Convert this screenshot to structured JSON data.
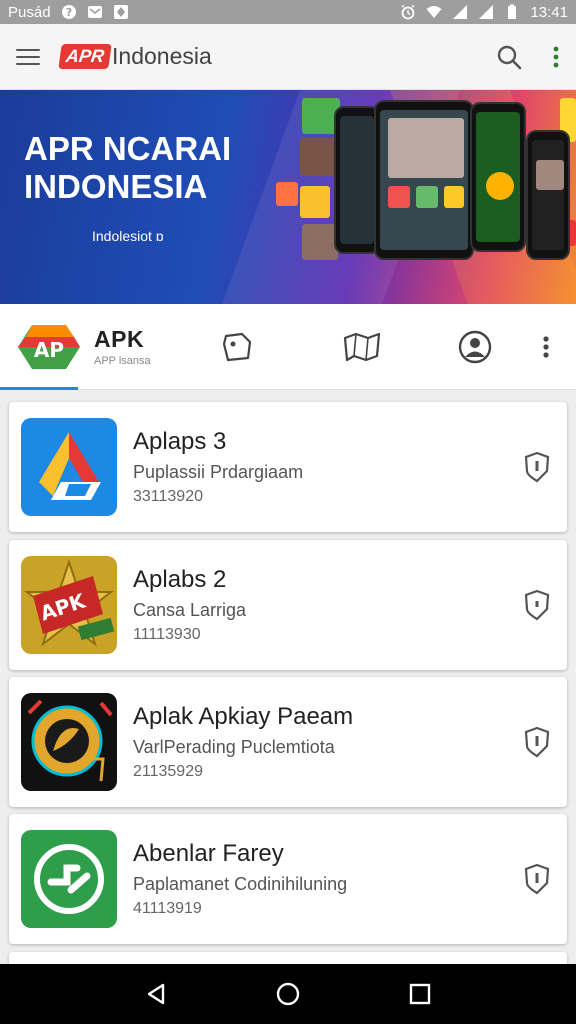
{
  "status_bar": {
    "left_label": "Pusád",
    "time": "13:41",
    "icons": [
      "help-icon",
      "mail-icon",
      "app-icon",
      "alarm-icon",
      "wifi-icon",
      "signal-icon",
      "signal-icon",
      "battery-icon"
    ]
  },
  "app_bar": {
    "brand_badge": "APR",
    "brand_text": "Indonesia",
    "actions": [
      "search-icon",
      "overflow-menu-icon"
    ]
  },
  "banner": {
    "title": "APR NCARAI INDONESIA",
    "subtitle": "Indolesiot ɒ"
  },
  "tabs": {
    "apk_title": "APK",
    "apk_subtitle": "APP lsansa",
    "icons": [
      "tag-icon",
      "map-icon",
      "profile-icon",
      "overflow-menu-icon"
    ]
  },
  "apps": [
    {
      "title": "Aplaps 3",
      "desc": "Puplassii Prdargiaam",
      "num": "33113920",
      "icon": "google-drive-style-icon",
      "action": "shield-icon"
    },
    {
      "title": "Aplabs 2",
      "desc": "Cansa Larriga",
      "num": "11113930",
      "icon": "apk-star-icon",
      "action": "shield-icon"
    },
    {
      "title": "Aplak Apkiay Paeam",
      "desc": "VarlPerading Puclemtiota",
      "num": "21135929",
      "icon": "compass-game-icon",
      "action": "shield-icon"
    },
    {
      "title": "Abenlar Farey",
      "desc": "Paplamanet Codinihiluning",
      "num": "41113919",
      "icon": "green-arrows-icon",
      "action": "shield-icon"
    }
  ],
  "colors": {
    "accent": "#1e88e5",
    "brand_red": "#e53935",
    "status_bar": "#9e9e9e",
    "nav_bar": "#000000"
  }
}
